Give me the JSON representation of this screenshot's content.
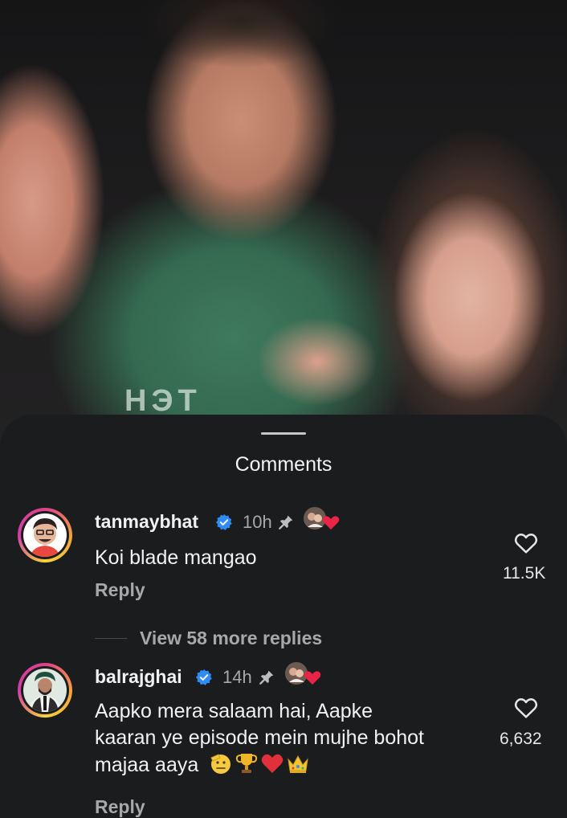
{
  "video": {
    "shirt_text": "НЭТ"
  },
  "sheet": {
    "title": "Comments"
  },
  "comments": [
    {
      "username": "tanmaybhat",
      "time": "10h",
      "text": "Koi blade mangao",
      "reply_label": "Reply",
      "likes": "11.5K",
      "view_more": "View 58 more replies"
    },
    {
      "username": "balrajghai",
      "time": "14h",
      "text_lines": [
        "Aapko mera salaam hai, Aapke",
        "kaaran ye episode mein mujhe bohot",
        "majaa aaya"
      ],
      "emojis": [
        "saluting-face",
        "trophy",
        "red-heart",
        "crown"
      ],
      "reply_label": "Reply",
      "likes": "6,632"
    }
  ],
  "icons": {
    "verified": "verified-badge-icon",
    "pin": "pin-icon",
    "like": "heart-outline-icon",
    "creator_liked": "creator-liked-heart-icon"
  },
  "colors": {
    "background": "#1b1c1e",
    "verified": "#2f8cf6",
    "heart": "#ea2448",
    "muted_text": "#a8a8a8"
  }
}
